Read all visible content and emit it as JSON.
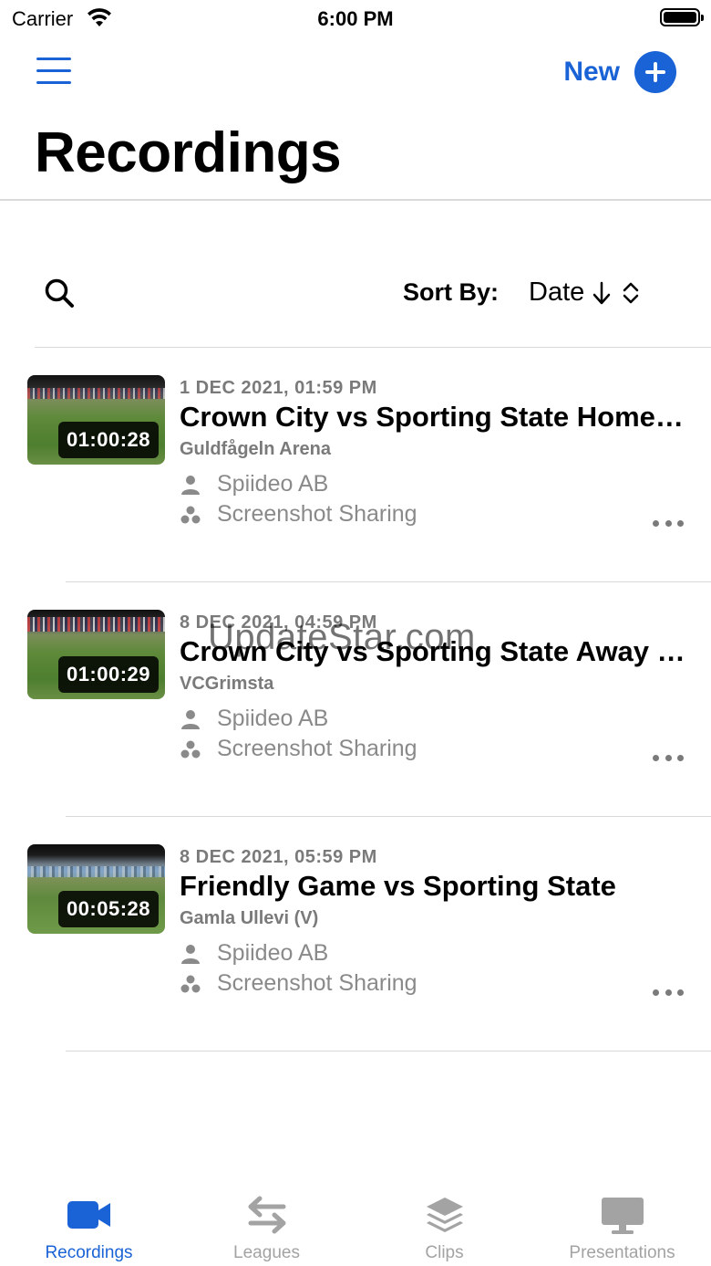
{
  "status_bar": {
    "carrier": "Carrier",
    "time": "6:00 PM"
  },
  "nav": {
    "new_label": "New"
  },
  "page_title": "Recordings",
  "sort": {
    "label": "Sort By:",
    "value": "Date"
  },
  "recordings": [
    {
      "date": "1 DEC 2021, 01:59 PM",
      "title": "Crown City vs Sporting State Home Game",
      "venue": "Guldfågeln Arena",
      "organization": "Spiideo AB",
      "team": "Screenshot Sharing",
      "duration": "01:00:28"
    },
    {
      "date": "8 DEC 2021, 04:59 PM",
      "title": "Crown City vs Sporting State Away Game",
      "venue": "VCGrimsta",
      "organization": "Spiideo AB",
      "team": "Screenshot Sharing",
      "duration": "01:00:29"
    },
    {
      "date": "8 DEC 2021, 05:59 PM",
      "title": "Friendly Game vs Sporting State",
      "venue": "Gamla Ullevi (V)",
      "organization": "Spiideo AB",
      "team": "Screenshot Sharing",
      "duration": "00:05:28"
    }
  ],
  "watermark": "UpdateStar.com",
  "tabs": [
    {
      "label": "Recordings",
      "icon": "video-camera-icon",
      "active": true
    },
    {
      "label": "Leagues",
      "icon": "swap-arrows-icon",
      "active": false
    },
    {
      "label": "Clips",
      "icon": "layers-icon",
      "active": false
    },
    {
      "label": "Presentations",
      "icon": "monitor-icon",
      "active": false
    }
  ],
  "colors": {
    "accent": "#1a63d6",
    "inactive": "#a3a3a3",
    "secondary_text": "#7a7a7a"
  }
}
